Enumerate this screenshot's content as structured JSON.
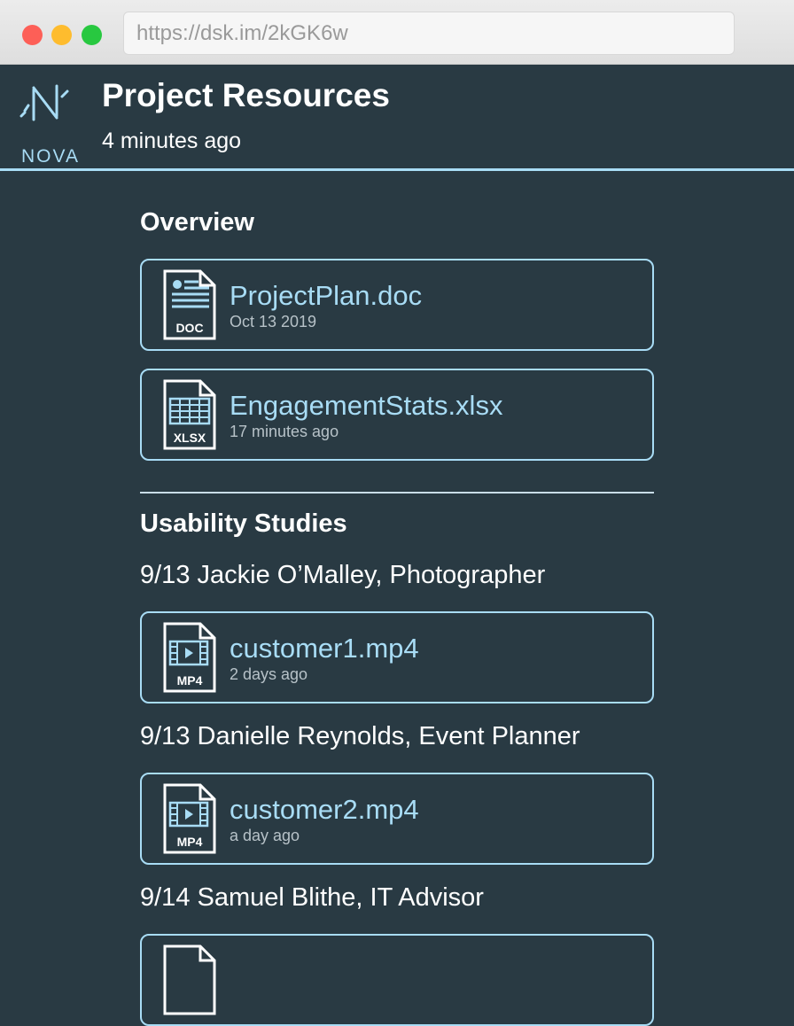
{
  "browser": {
    "url": "https://dsk.im/2kGK6w"
  },
  "brand": {
    "logo_text": "NOVA"
  },
  "header": {
    "title": "Project Resources",
    "subtitle": "4 minutes ago"
  },
  "sections": {
    "overview": {
      "title": "Overview",
      "files": [
        {
          "name": "ProjectPlan.doc",
          "meta": "Oct 13 2019",
          "type": "DOC",
          "icon": "doc-file-icon"
        },
        {
          "name": "EngagementStats.xlsx",
          "meta": "17 minutes ago",
          "type": "XLSX",
          "icon": "xlsx-file-icon"
        }
      ]
    },
    "usability": {
      "title": "Usability Studies",
      "studies": [
        {
          "label": "9/13 Jackie O’Malley, Photographer",
          "file": {
            "name": "customer1.mp4",
            "meta": "2 days ago",
            "type": "MP4",
            "icon": "mp4-file-icon"
          }
        },
        {
          "label": "9/13 Danielle Reynolds, Event Planner",
          "file": {
            "name": "customer2.mp4",
            "meta": "a day ago",
            "type": "MP4",
            "icon": "mp4-file-icon"
          }
        },
        {
          "label": "9/14 Samuel Blithe, IT Advisor",
          "file": {
            "name": "",
            "meta": "",
            "type": "",
            "icon": "file-icon"
          }
        }
      ]
    }
  },
  "colors": {
    "background": "#293a43",
    "accent": "#a8dcf5",
    "text": "#ffffff"
  }
}
